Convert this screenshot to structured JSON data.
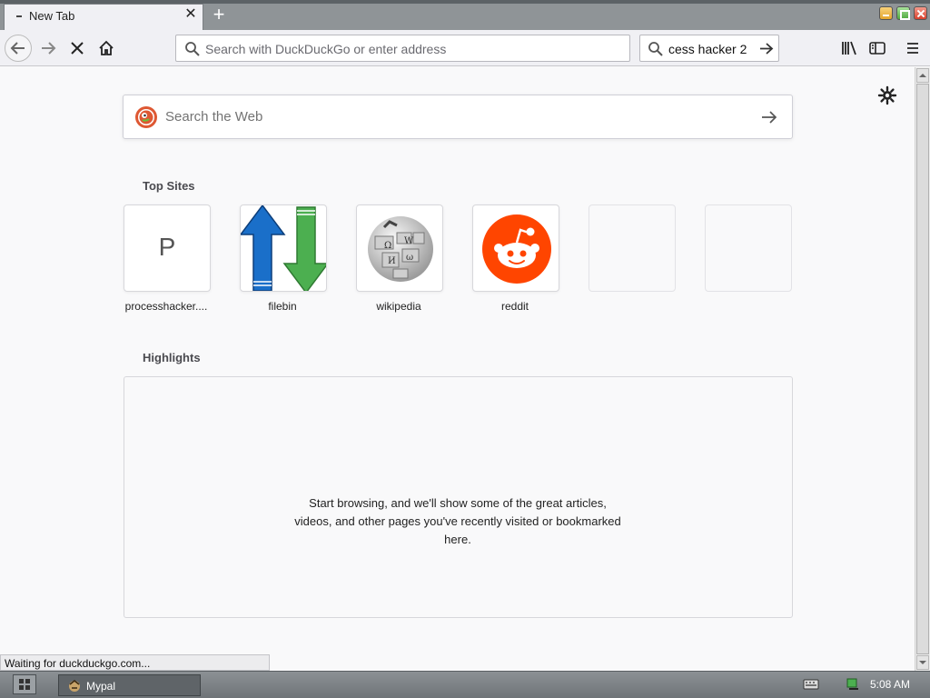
{
  "window": {
    "tab_title": "New Tab",
    "new_tab_symbol": "+",
    "close_tab_symbol": "✕"
  },
  "toolbar": {
    "url_placeholder": "Search with DuckDuckGo or enter address",
    "search_value": "cess hacker 2"
  },
  "newtab": {
    "web_search_placeholder": "Search the Web",
    "top_sites_title": "Top Sites",
    "top_sites": [
      {
        "label": "processhacker....",
        "letter": "P"
      },
      {
        "label": "filebin"
      },
      {
        "label": "wikipedia"
      },
      {
        "label": "reddit"
      },
      {
        "label": ""
      },
      {
        "label": ""
      }
    ],
    "highlights_title": "Highlights",
    "highlights_empty_message": "Start browsing, and we'll show some of the great articles, videos, and other pages you've recently visited or bookmarked here."
  },
  "status": {
    "text": "Waiting for duckduckgo.com..."
  },
  "taskbar": {
    "app_label": "Mypal",
    "clock": "5:08 AM"
  },
  "colors": {
    "reddit": "#ff4500",
    "filebin_up": "#1a6fc9",
    "filebin_down": "#4caf50",
    "duckduckgo": "#de5833"
  }
}
